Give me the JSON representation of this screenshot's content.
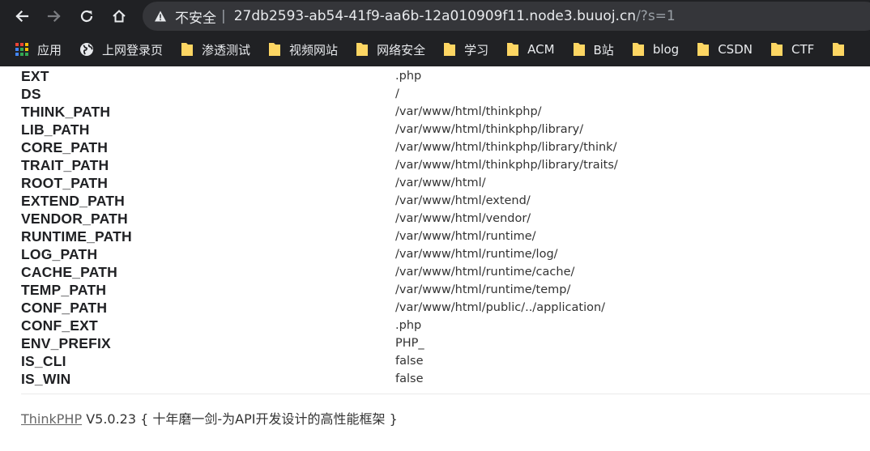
{
  "browser": {
    "address": {
      "security_label": "不安全",
      "separator": "|",
      "host": "27db2593-ab54-41f9-aa6b-12a010909f11.node3.buuoj.cn",
      "path": "/?s=1"
    },
    "bookmarks": [
      {
        "label": "应用",
        "icon": "apps-grid-icon"
      },
      {
        "label": "上网登录页",
        "icon": "globe-icon"
      },
      {
        "label": "渗透测试",
        "icon": "folder-icon"
      },
      {
        "label": "视频网站",
        "icon": "folder-icon"
      },
      {
        "label": "网络安全",
        "icon": "folder-icon"
      },
      {
        "label": "学习",
        "icon": "folder-icon"
      },
      {
        "label": "ACM",
        "icon": "folder-icon"
      },
      {
        "label": "B站",
        "icon": "folder-icon"
      },
      {
        "label": "blog",
        "icon": "folder-icon"
      },
      {
        "label": "CSDN",
        "icon": "folder-icon"
      },
      {
        "label": "CTF",
        "icon": "folder-icon"
      }
    ],
    "colors": {
      "chrome_bg": "#202124",
      "omnibox_bg": "#35363a",
      "folder": "#fdd663"
    }
  },
  "constants": [
    {
      "name": "EXT",
      "value": ".php"
    },
    {
      "name": "DS",
      "value": "/"
    },
    {
      "name": "THINK_PATH",
      "value": "/var/www/html/thinkphp/"
    },
    {
      "name": "LIB_PATH",
      "value": "/var/www/html/thinkphp/library/"
    },
    {
      "name": "CORE_PATH",
      "value": "/var/www/html/thinkphp/library/think/"
    },
    {
      "name": "TRAIT_PATH",
      "value": "/var/www/html/thinkphp/library/traits/"
    },
    {
      "name": "ROOT_PATH",
      "value": "/var/www/html/"
    },
    {
      "name": "EXTEND_PATH",
      "value": "/var/www/html/extend/"
    },
    {
      "name": "VENDOR_PATH",
      "value": "/var/www/html/vendor/"
    },
    {
      "name": "RUNTIME_PATH",
      "value": "/var/www/html/runtime/"
    },
    {
      "name": "LOG_PATH",
      "value": "/var/www/html/runtime/log/"
    },
    {
      "name": "CACHE_PATH",
      "value": "/var/www/html/runtime/cache/"
    },
    {
      "name": "TEMP_PATH",
      "value": "/var/www/html/runtime/temp/"
    },
    {
      "name": "CONF_PATH",
      "value": "/var/www/html/public/../application/"
    },
    {
      "name": "CONF_EXT",
      "value": ".php"
    },
    {
      "name": "ENV_PREFIX",
      "value": "PHP_"
    },
    {
      "name": "IS_CLI",
      "value": "false"
    },
    {
      "name": "IS_WIN",
      "value": "false"
    }
  ],
  "footer": {
    "link": "ThinkPHP",
    "version": "V5.0.23",
    "slogan": "{ 十年磨一剑-为API开发设计的高性能框架 }"
  }
}
